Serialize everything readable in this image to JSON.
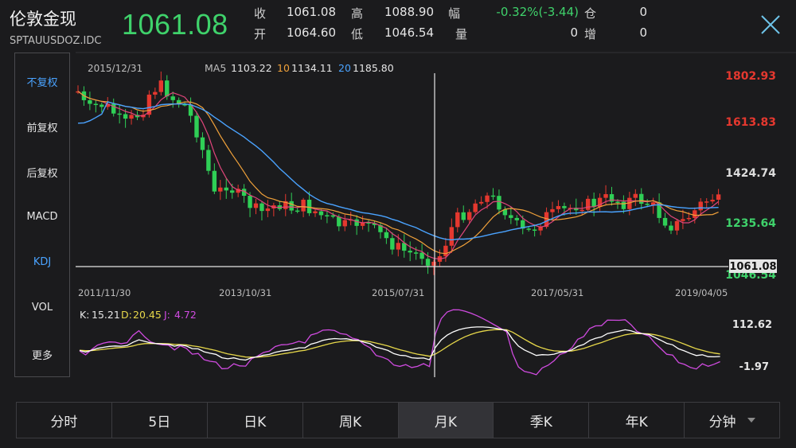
{
  "header": {
    "name": "伦敦金现",
    "code": "SPTAUUSDOZ.IDC",
    "price": "1061.08"
  },
  "quote": {
    "close_label": "收",
    "close": "1061.08",
    "open_label": "开",
    "open": "1064.60",
    "high_label": "高",
    "high": "1088.90",
    "low_label": "低",
    "low": "1046.54",
    "change_label": "幅",
    "change": "-0.32%(-3.44)",
    "volume_label": "量",
    "volume": "0",
    "position_label": "仓",
    "position": "0",
    "increase_label": "增",
    "increase": "0"
  },
  "sidebar": {
    "items": [
      {
        "label": "不复权",
        "active": true
      },
      {
        "label": "前复权",
        "active": false
      },
      {
        "label": "后复权",
        "active": false
      },
      {
        "label": "MACD",
        "active": false
      },
      {
        "label": "KDJ",
        "active": true
      },
      {
        "label": "VOL",
        "active": false
      },
      {
        "label": "更多",
        "active": false
      }
    ]
  },
  "chart_data": {
    "type": "candlestick",
    "cursor_date": "2015/12/31",
    "ma": [
      {
        "label": "MA5",
        "value": "1103.22",
        "color": "#e0457b"
      },
      {
        "label": "10",
        "value": "1134.11",
        "color": "#f0a13a"
      },
      {
        "label": "20",
        "value": "1185.80",
        "color": "#4aa3ff"
      }
    ],
    "price_axis": {
      "ticks": [
        "1802.93",
        "1613.83",
        "1424.74",
        "1235.64"
      ],
      "current": "1061.08",
      "hidden_low": "1046.54",
      "range": [
        1046.54,
        1802.93
      ]
    },
    "date_ticks": [
      "2011/11/30",
      "2013/10/31",
      "2015/07/31",
      "2017/05/31",
      "2019/04/05"
    ],
    "kdj": {
      "k": "15.21",
      "d": "20.45",
      "j": "4.72",
      "k_label": "K:",
      "d_label": "D:",
      "j_label": "J:",
      "axis_top": "112.62",
      "axis_bottom": "-1.97"
    },
    "colors": {
      "up": "#e5382f",
      "down": "#2fcf56",
      "kline": "#ffffff",
      "dline": "#e7d84a",
      "jline": "#d04be0"
    }
  },
  "tabs": [
    {
      "label": "分时",
      "active": false
    },
    {
      "label": "5日",
      "active": false
    },
    {
      "label": "日K",
      "active": false
    },
    {
      "label": "周K",
      "active": false
    },
    {
      "label": "月K",
      "active": true
    },
    {
      "label": "季K",
      "active": false
    },
    {
      "label": "年K",
      "active": false
    },
    {
      "label": "分钟",
      "active": false,
      "dropdown": true
    }
  ]
}
